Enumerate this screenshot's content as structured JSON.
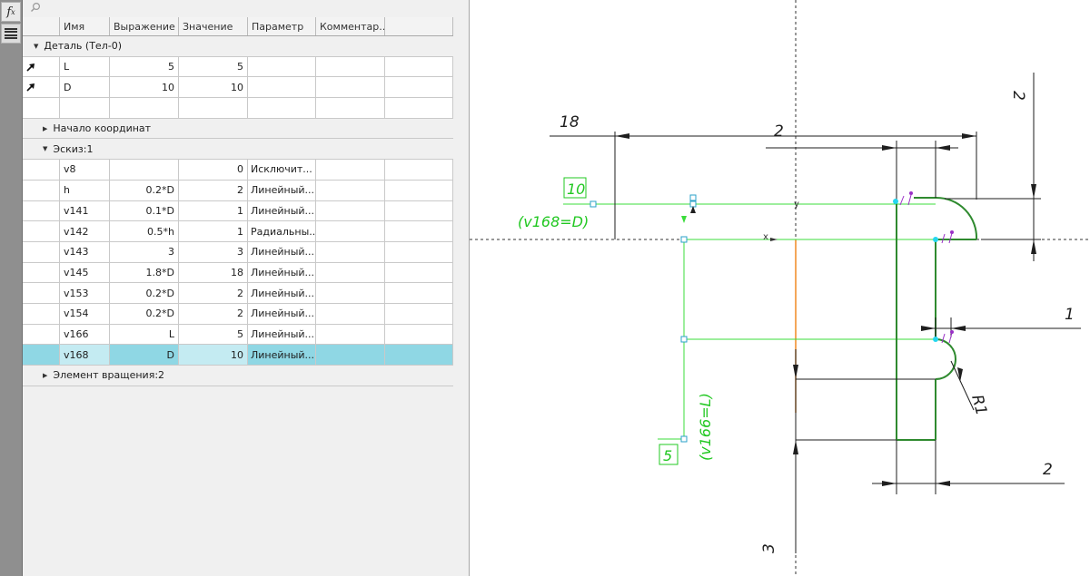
{
  "toolbar": {
    "fx_label": "f",
    "fx_sub": "x",
    "icons": [
      "fx-icon",
      "menu-icon"
    ]
  },
  "panel": {
    "columns": [
      "Имя",
      "Выражение",
      "Значение",
      "Параметр",
      "Комментар..."
    ],
    "groups": {
      "part": "Деталь (Тел-0)",
      "origin": "Начало координат",
      "sketch": "Эскиз:1",
      "revolve": "Элемент вращения:2"
    },
    "part_rows": [
      {
        "name": "L",
        "expr": "5",
        "value": "5",
        "param": "",
        "comment": ""
      },
      {
        "name": "D",
        "expr": "10",
        "value": "10",
        "param": "",
        "comment": ""
      },
      {
        "name": "",
        "expr": "",
        "value": "",
        "param": "",
        "comment": ""
      }
    ],
    "sketch_rows": [
      {
        "name": "v8",
        "expr": "",
        "value": "0",
        "param": "Исключит...",
        "comment": ""
      },
      {
        "name": "h",
        "expr": "0.2*D",
        "value": "2",
        "param": "Линейный...",
        "comment": ""
      },
      {
        "name": "v141",
        "expr": "0.1*D",
        "value": "1",
        "param": "Линейный...",
        "comment": ""
      },
      {
        "name": "v142",
        "expr": "0.5*h",
        "value": "1",
        "param": "Радиальны...",
        "comment": ""
      },
      {
        "name": "v143",
        "expr": "3",
        "value": "3",
        "param": "Линейный...",
        "comment": ""
      },
      {
        "name": "v145",
        "expr": "1.8*D",
        "value": "18",
        "param": "Линейный...",
        "comment": ""
      },
      {
        "name": "v153",
        "expr": "0.2*D",
        "value": "2",
        "param": "Линейный...",
        "comment": ""
      },
      {
        "name": "v154",
        "expr": "0.2*D",
        "value": "2",
        "param": "Линейный...",
        "comment": ""
      },
      {
        "name": "v166",
        "expr": "L",
        "value": "5",
        "param": "Линейный...",
        "comment": ""
      },
      {
        "name": "v168",
        "expr": "D",
        "value": "10",
        "param": "Линейный...",
        "comment": ""
      }
    ],
    "selected_row": "v168"
  },
  "drawing": {
    "dim_18": "18",
    "dim_2_top": "2",
    "dim_2_right": "2",
    "dim_1": "1",
    "dim_r1": "R1",
    "dim_2_bottom": "2",
    "dim_3": "3",
    "axis_x": "x",
    "axis_y": "y",
    "green_value_top": "10",
    "green_expr_top": "(v168=D)",
    "green_value_left": "5",
    "green_expr_left": "(v166=L)",
    "colors": {
      "geometry": "#2f8a2f",
      "driving": "#3bdc3b",
      "axis": "#f08a24",
      "point": "#25d7ef",
      "constraint": "#9a30c6",
      "dimension": "#1e1e1e"
    }
  }
}
